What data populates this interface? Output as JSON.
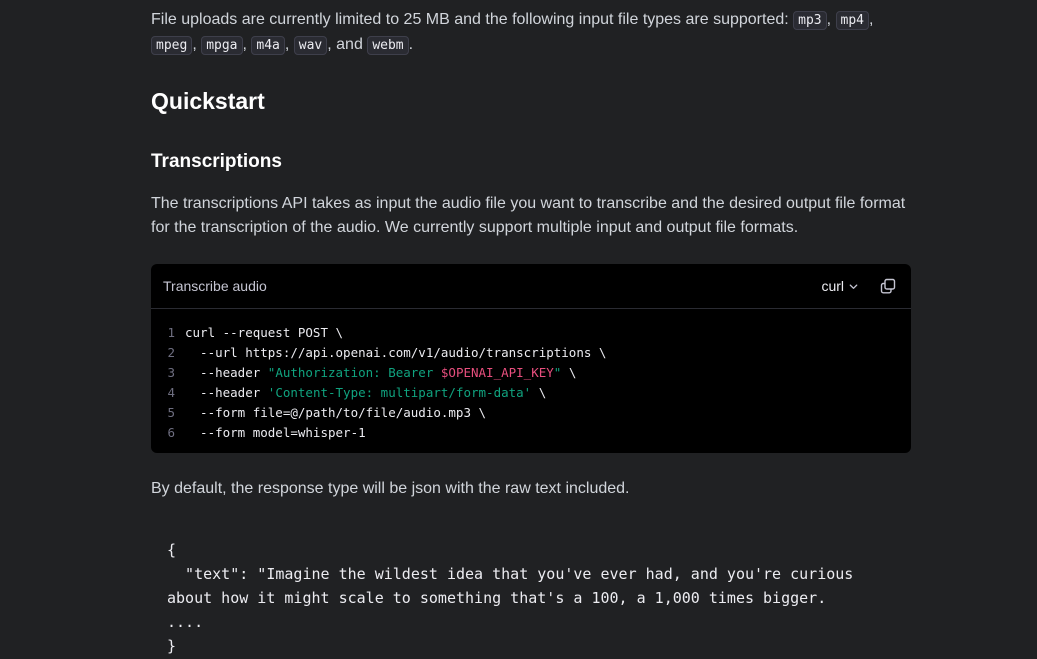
{
  "intro": {
    "text_before": "File uploads are currently limited to 25 MB and the following input file types are supported:",
    "types": [
      "mp3",
      "mp4",
      "mpeg",
      "mpga",
      "m4a",
      "wav",
      "webm"
    ],
    "and_word": "and"
  },
  "headings": {
    "quickstart": "Quickstart",
    "transcriptions": "Transcriptions"
  },
  "description": "The transcriptions API takes as input the audio file you want to transcribe and the desired output file format for the transcription of the audio. We currently support multiple input and output file formats.",
  "code_block": {
    "title": "Transcribe audio",
    "language": "curl",
    "lines": [
      {
        "n": "1",
        "parts": [
          {
            "t": "curl --request POST \\",
            "k": "plain"
          }
        ]
      },
      {
        "n": "2",
        "parts": [
          {
            "t": "  --url https://api.openai.com/v1/audio/transcriptions \\",
            "k": "plain"
          }
        ]
      },
      {
        "n": "3",
        "parts": [
          {
            "t": "  --header ",
            "k": "plain"
          },
          {
            "t": "\"Authorization: Bearer ",
            "k": "str"
          },
          {
            "t": "$OPENAI_API_KEY",
            "k": "var"
          },
          {
            "t": "\"",
            "k": "str"
          },
          {
            "t": " \\",
            "k": "plain"
          }
        ]
      },
      {
        "n": "4",
        "parts": [
          {
            "t": "  --header ",
            "k": "plain"
          },
          {
            "t": "'Content-Type: multipart/form-data'",
            "k": "str"
          },
          {
            "t": " \\",
            "k": "plain"
          }
        ]
      },
      {
        "n": "5",
        "parts": [
          {
            "t": "  --form file=@/path/to/file/audio.mp3 \\",
            "k": "plain"
          }
        ]
      },
      {
        "n": "6",
        "parts": [
          {
            "t": "  --form model=whisper-1",
            "k": "plain"
          }
        ]
      }
    ]
  },
  "after_text": "By default, the response type will be json with the raw text included.",
  "json_example": "{\n  \"text\": \"Imagine the wildest idea that you've ever had, and you're curious\nabout how it might scale to something that's a 100, a 1,000 times bigger.\n....\n}"
}
